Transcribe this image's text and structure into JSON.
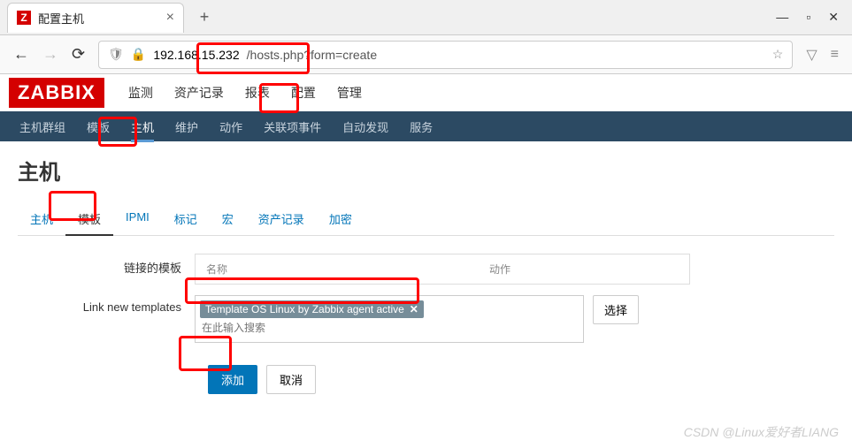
{
  "browser": {
    "tab_title": "配置主机",
    "url_ip": "192.168.15.232",
    "url_path": "/hosts.php?form=create",
    "new_tab": "+",
    "close": "×",
    "star": "☆"
  },
  "header": {
    "logo": "ZABBIX",
    "menu": [
      "监测",
      "资产记录",
      "报表",
      "配置",
      "管理"
    ],
    "active_menu": "配置"
  },
  "subnav": {
    "items": [
      "主机群组",
      "模板",
      "主机",
      "维护",
      "动作",
      "关联项事件",
      "自动发现",
      "服务"
    ],
    "active": "主机"
  },
  "page": {
    "title": "主机"
  },
  "form_tabs": {
    "items": [
      "主机",
      "模板",
      "IPMI",
      "标记",
      "宏",
      "资产记录",
      "加密"
    ],
    "active": "模板"
  },
  "form": {
    "linked_label": "链接的模板",
    "linked_col_name": "名称",
    "linked_col_action": "动作",
    "link_new_label": "Link new templates",
    "template_tag": "Template OS Linux by Zabbix agent active",
    "search_placeholder": "在此输入搜索",
    "select_btn": "选择",
    "add_btn": "添加",
    "cancel_btn": "取消"
  },
  "watermark": "CSDN @Linux爱好者LIANG"
}
